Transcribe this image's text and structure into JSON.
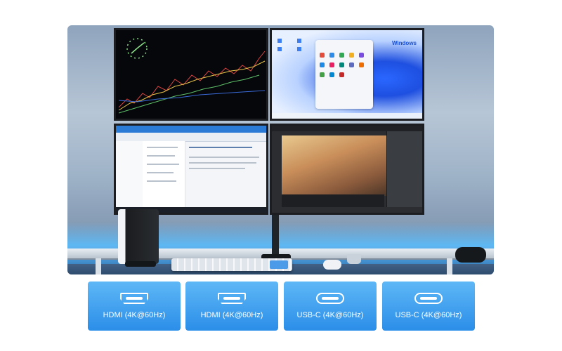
{
  "screens": {
    "windows_brand": "Windows"
  },
  "ports": [
    {
      "label": "HDMI (4K@60Hz)",
      "icon": "hdmi-port-icon"
    },
    {
      "label": "HDMI (4K@60Hz)",
      "icon": "hdmi-port-icon"
    },
    {
      "label": "USB-C (4K@60Hz)",
      "icon": "usb-c-port-icon"
    },
    {
      "label": "USB-C (4K@60Hz)",
      "icon": "usb-c-port-icon"
    }
  ],
  "colors": {
    "badge_top": "#5eb7f6",
    "badge_bottom": "#2b8ee8",
    "ambient_glow": "#5abeff"
  }
}
